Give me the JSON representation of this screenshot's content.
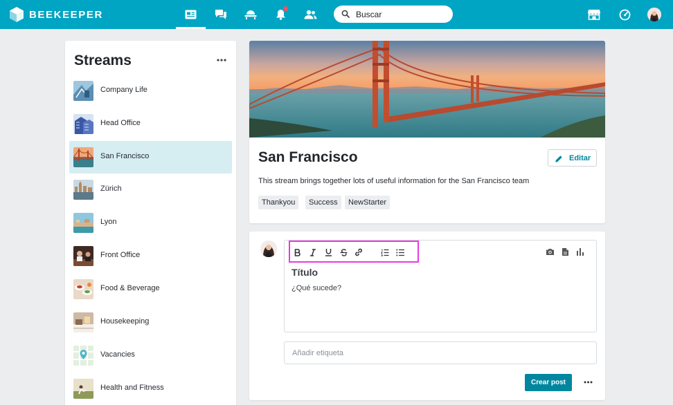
{
  "brand": {
    "name": "BEEKEEPER"
  },
  "search": {
    "placeholder": "Buscar"
  },
  "sidebar": {
    "title": "Streams",
    "items": [
      {
        "label": "Company Life",
        "active": false
      },
      {
        "label": "Head Office",
        "active": false
      },
      {
        "label": "San Francisco",
        "active": true
      },
      {
        "label": "Zürich",
        "active": false
      },
      {
        "label": "Lyon",
        "active": false
      },
      {
        "label": "Front Office",
        "active": false
      },
      {
        "label": "Food & Beverage",
        "active": false
      },
      {
        "label": "Housekeeping",
        "active": false
      },
      {
        "label": "Vacancies",
        "active": false
      },
      {
        "label": "Health and Fitness",
        "active": false
      }
    ]
  },
  "stream": {
    "title": "San Francisco",
    "edit_label": "Editar",
    "description": "This stream brings together lots of useful information for the San Francisco team",
    "tags": [
      "Thankyou",
      "Success",
      "NewStarter"
    ]
  },
  "composer": {
    "title_placeholder": "Título",
    "body_placeholder": "¿Qué sucede?",
    "tag_placeholder": "Añadir etiqueta",
    "submit_label": "Crear post"
  },
  "colors": {
    "topbar": "#00a5c4",
    "accent": "#00879f",
    "active_item": "#d6edf2",
    "highlight_box": "#e83adf",
    "notification": "#ff4d5e"
  },
  "icons": {
    "nav": [
      "news-feed-icon",
      "chat-icon",
      "campus-icon",
      "notifications-bell-icon",
      "people-icon"
    ],
    "right": [
      "store-icon",
      "dashboard-icon"
    ],
    "toolbar": [
      "bold-icon",
      "italic-icon",
      "underline-icon",
      "strikethrough-icon",
      "link-icon",
      "numbered-list-icon",
      "bullet-list-icon"
    ],
    "media": [
      "camera-icon",
      "file-icon",
      "poll-icon"
    ]
  }
}
